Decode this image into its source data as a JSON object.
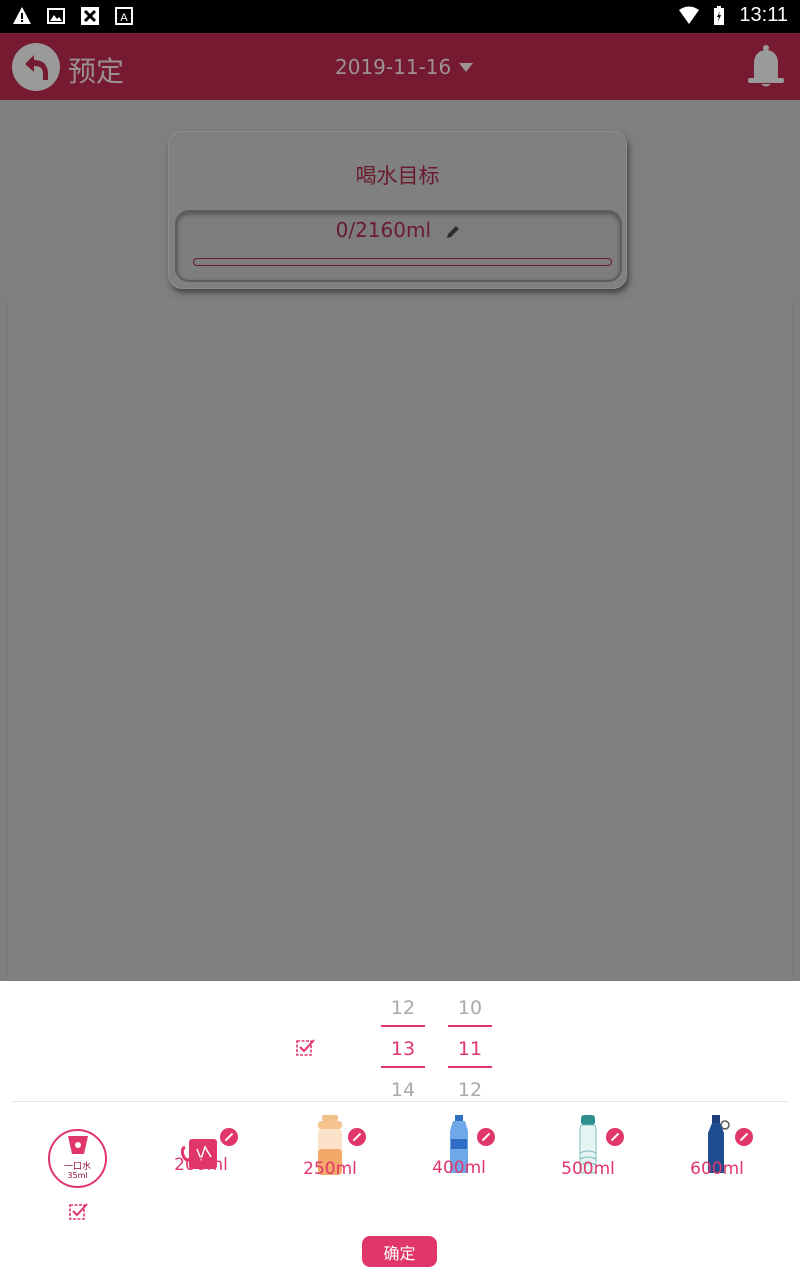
{
  "status_bar": {
    "time": "13:11",
    "icons": [
      "warning-icon",
      "image-icon",
      "blocked-icon",
      "a-icon",
      "wifi-icon",
      "battery-icon"
    ]
  },
  "app_bar": {
    "title": "预定",
    "date": "2019-11-16"
  },
  "goal": {
    "title": "喝水目标",
    "value": "0/2160ml",
    "progress": 0
  },
  "time_picker": {
    "hours": [
      "12",
      "13",
      "14"
    ],
    "minutes": [
      "10",
      "11",
      "12"
    ],
    "selected_hour": "13",
    "selected_minute": "11"
  },
  "cups": [
    {
      "label": "",
      "ring_text": "一口水",
      "ring_volume": "35ml",
      "selected": true
    },
    {
      "label": "200ml"
    },
    {
      "label": "250ml"
    },
    {
      "label": "400ml"
    },
    {
      "label": "500ml"
    },
    {
      "label": "600ml"
    }
  ],
  "confirm_label": "确定",
  "colors": {
    "accent": "#e0366a",
    "app_bar": "#761a32",
    "overlay": "#7f7f7f"
  }
}
